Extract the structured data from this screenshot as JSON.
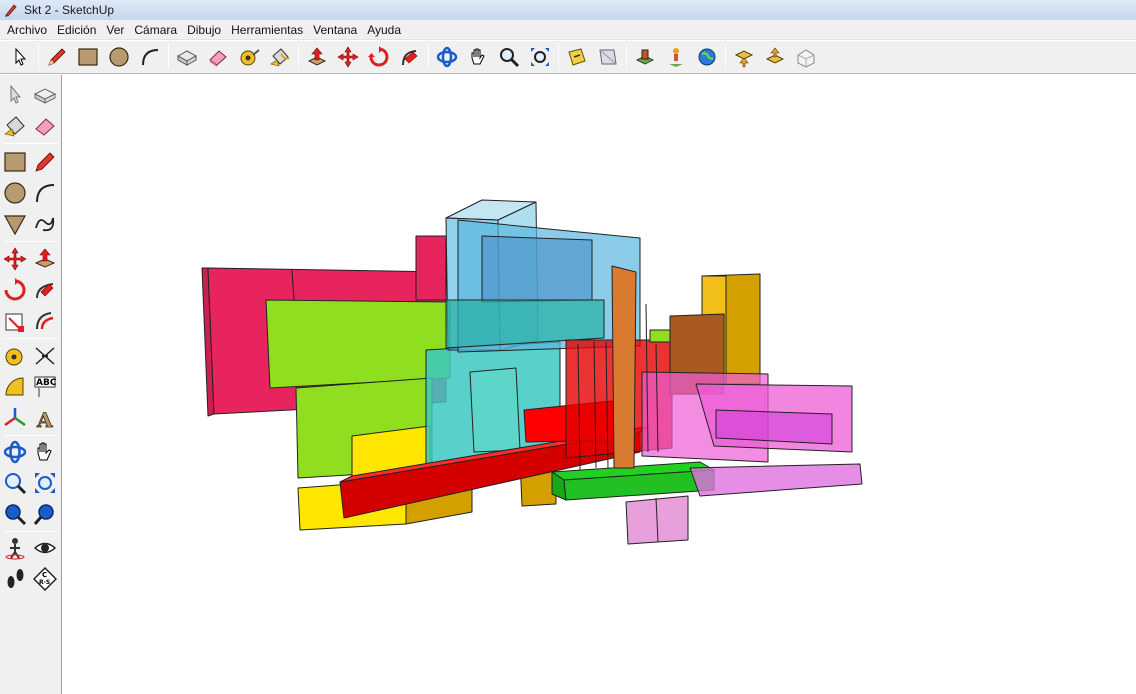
{
  "window": {
    "title": "Skt 2 - SketchUp"
  },
  "menubar": {
    "items": [
      "Archivo",
      "Edición",
      "Ver",
      "Cámara",
      "Dibujo",
      "Herramientas",
      "Ventana",
      "Ayuda"
    ]
  },
  "toolbar": {
    "icons": [
      "select-icon",
      "pencil-icon",
      "rectangle-icon",
      "circle-icon",
      "arc-icon",
      "make-component-icon",
      "eraser-icon",
      "tape-measure-icon",
      "paint-bucket-icon",
      "push-pull-icon",
      "move-icon",
      "rotate-icon",
      "follow-me-icon",
      "orbit-icon",
      "pan-icon",
      "zoom-icon",
      "zoom-extents-icon",
      "section-plane-icon",
      "previous-view-icon",
      "warehouse-model-icon",
      "place-model-icon",
      "google-earth-icon",
      "get-models-icon",
      "share-model-icon",
      "component-3d-icon"
    ]
  },
  "left_toolbar": {
    "abc_label": "ABC",
    "axis_label": "A",
    "compass_c": "C",
    "compass_r": "R·S"
  },
  "colors": {
    "crimson": "#e8245e",
    "lime": "#8fde20",
    "teal": "#3cc8c0",
    "sky": "#5ab8de",
    "red": "#e60000",
    "yellow": "#ffe600",
    "gold": "#d4a000",
    "orange": "#d87a30",
    "magenta": "#ec5cd6",
    "green": "#22d022",
    "pink": "#e696d8"
  }
}
